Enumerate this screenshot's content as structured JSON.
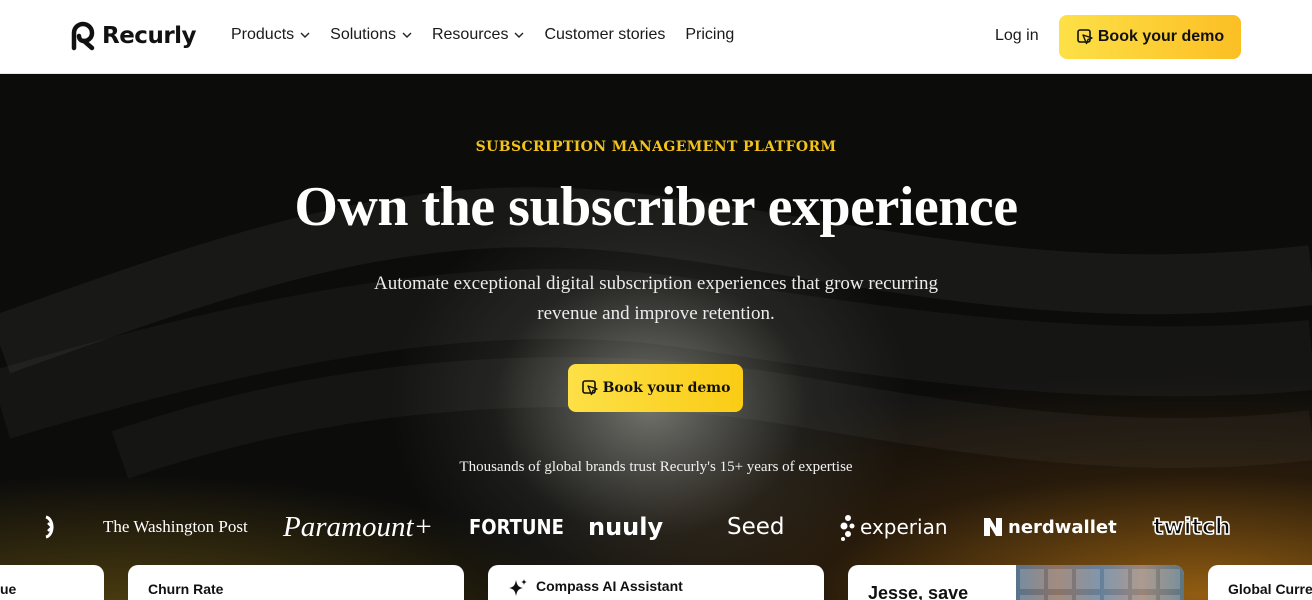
{
  "nav": {
    "brand": "Recurly",
    "menu": [
      {
        "label": "Products",
        "dropdown": true
      },
      {
        "label": "Solutions",
        "dropdown": true
      },
      {
        "label": "Resources",
        "dropdown": true
      },
      {
        "label": "Customer stories",
        "dropdown": false
      },
      {
        "label": "Pricing",
        "dropdown": false
      }
    ],
    "login": "Log in",
    "cta": "Book your demo"
  },
  "hero": {
    "eyebrow": "SUBSCRIPTION MANAGEMENT PLATFORM",
    "headline": "Own the subscriber experience",
    "subline": "Automate exceptional digital subscription experiences that grow recurring revenue and improve retention.",
    "cta": "Book your demo",
    "trust_text": "Thousands of global brands trust Recurly's 15+ years of expertise"
  },
  "logos": [
    "The Washington Post",
    "Paramount+",
    "FORTUNE",
    "nuuly",
    "Seed",
    "experian",
    "nerdwallet",
    "twitch"
  ],
  "cards": [
    {
      "title": "ue"
    },
    {
      "title": "Churn Rate"
    },
    {
      "title": "Compass AI Assistant",
      "icon": "sparkle-icon"
    },
    {
      "title": "Jesse, save"
    },
    {
      "title": "Global Curre"
    }
  ],
  "colors": {
    "accent": "#fbbf24",
    "eyebrow": "#f2c319",
    "background": "#0c0c0b"
  }
}
